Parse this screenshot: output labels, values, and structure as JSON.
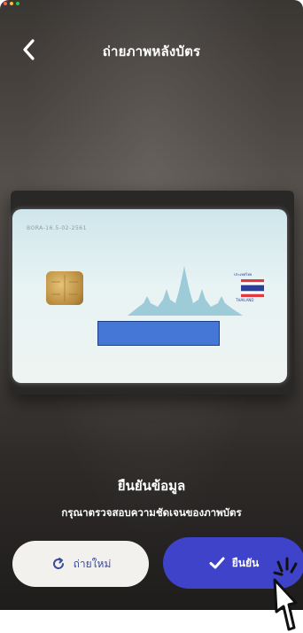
{
  "header": {
    "back_icon": "chevron-left-icon",
    "title": "ถ่ายภาพหลังบัตร"
  },
  "card": {
    "id_text": "BORA-16.5-02-2561",
    "flag_label_top": "ประเทศไทย",
    "flag_label_bottom": "THAILAND"
  },
  "confirm": {
    "title": "ยืนยันข้อมูล",
    "subtitle": "กรุณาตรวจสอบความชัดเจนของภาพบัตร"
  },
  "buttons": {
    "retake_label": "ถ่ายใหม่",
    "retake_icon": "refresh-icon",
    "confirm_label": "ยืนยัน",
    "confirm_icon": "checkmark-icon"
  },
  "colors": {
    "primary": "#3f43c9",
    "secondary_text": "#3b4c9c",
    "redaction": "#4477d6"
  }
}
